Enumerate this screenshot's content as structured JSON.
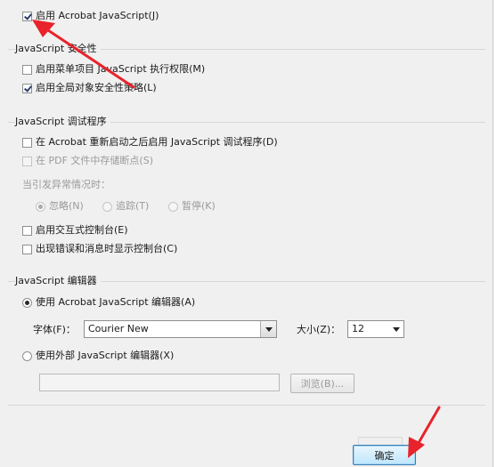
{
  "enable_js": {
    "label": "启用 Acrobat JavaScript(J)",
    "checked": true
  },
  "security": {
    "title": "JavaScript 安全性",
    "items": [
      {
        "label": "启用菜单项目 JavaScript 执行权限(M)",
        "checked": false
      },
      {
        "label": "启用全局对象安全性策略(L)",
        "checked": true
      }
    ]
  },
  "debugger": {
    "title": "JavaScript 调试程序",
    "enable_after_restart": {
      "label": "在 Acrobat 重新启动之后启用 JavaScript 调试程序(D)",
      "checked": false
    },
    "store_breakpoints": {
      "label": "在 PDF 文件中存储断点(S)",
      "checked": false,
      "disabled": true
    },
    "exception_label": "当引发异常情况时：",
    "exception_options": [
      {
        "label": "忽略(N)",
        "selected": true
      },
      {
        "label": "追踪(T)",
        "selected": false
      },
      {
        "label": "暂停(K)",
        "selected": false
      }
    ],
    "interactive_console": {
      "label": "启用交互式控制台(E)",
      "checked": false
    },
    "show_console_on_error": {
      "label": "出现错误和消息时显示控制台(C)",
      "checked": false
    }
  },
  "editor": {
    "title": "JavaScript 编辑器",
    "use_acrobat_editor": {
      "label": "使用 Acrobat JavaScript 编辑器(A)",
      "selected": true
    },
    "font_label": "字体(F)：",
    "font_value": "Courier New",
    "size_label": "大小(Z)：",
    "size_value": "12",
    "use_external_editor": {
      "label": "使用外部 JavaScript 编辑器(X)",
      "selected": false
    },
    "external_path": "",
    "browse_label": "浏览(B)..."
  },
  "ok_button": "确定",
  "colors": {
    "annotation_arrow": "#e8232b",
    "primary_button_border": "#3c7fb1",
    "panel_bg": "#f0f0f0"
  }
}
